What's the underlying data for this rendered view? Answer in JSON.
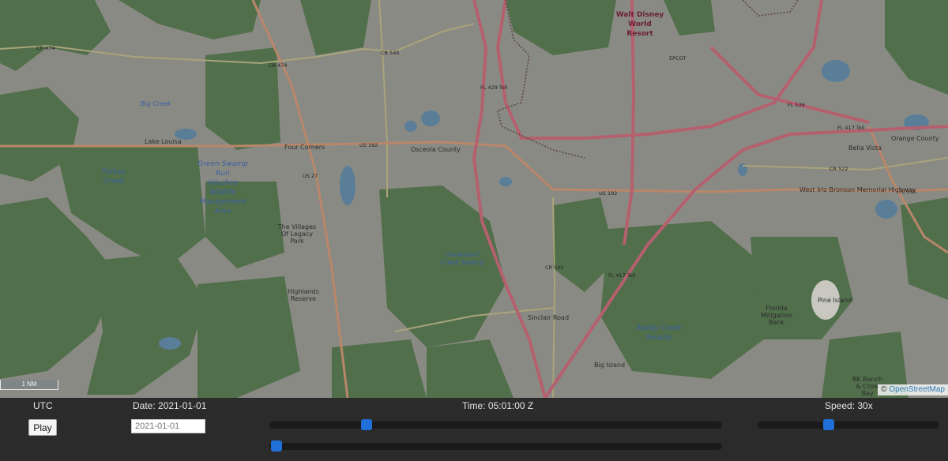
{
  "map": {
    "scale_label": "1 NM",
    "attribution_symbol": "©",
    "attribution_link": "OpenStreetMap",
    "labels": {
      "cr474_a": "CR 474",
      "cr474_b": "CR 474",
      "cr545_top": "CR 545",
      "cr545_mid": "CR 545",
      "fl429": "FL 429 Toll",
      "fl536": "FL 536",
      "fl417_top": "FL 417 Toll",
      "fl417_mid": "FL 417 Toll",
      "cr522": "CR 522",
      "fl535": "FL 535",
      "us192_left": "US 192",
      "us192_right": "US 192",
      "us27": "US 27",
      "four_corners": "Four Corners",
      "wdw_line1": "Walt Disney",
      "wdw_line2": "World",
      "wdw_line3": "Resort",
      "epcot": "EPCOT",
      "turkey_line1": "Turkey",
      "turkey_line2": "Creek",
      "gsr_line1": "Green Swamp",
      "gsr_line2": "Run",
      "gsr_line3": "Hilochee",
      "gsr_line4": "Wildlife",
      "gsr_line5": "Management",
      "gsr_line6": "Area",
      "big_creek": "Big Creek",
      "lake_line": "Lake Louisa",
      "davenport_line1": "Davenport",
      "davenport_line2": "Creek Swamp",
      "reedy_line1": "Reedy Creek",
      "reedy_line2": "Swamp",
      "pine_island": "Pine Island",
      "big_island": "Big Island",
      "osceola_county": "Osceola County",
      "orange_county": "Orange County",
      "villages_line1": "The Villages",
      "villages_line2": "Of Legacy",
      "villages_line3": "Park",
      "highlands_line1": "Highlands",
      "highlands_line2": "Reserve",
      "sinclair": "Sinclair Road",
      "florida_line1": "Florida",
      "florida_line2": "Mitigation",
      "florida_line3": "Bank",
      "bk_line1": "BK Ranch",
      "bk_line2": "& Crow",
      "bk_line3": "Bay",
      "bella_vista": "Bella Vista",
      "irlo": "West Irlo Bronson Memorial Highway"
    }
  },
  "controls": {
    "timezone_label": "UTC",
    "play_label": "Play",
    "date_label": "Date: 2021-01-01",
    "date_placeholder": "2021-01-01",
    "time_label": "Time: 05:01:00 Z",
    "speed_label": "Speed: 30x",
    "time_slider_fraction": 0.215,
    "second_slider_fraction": 0.015,
    "speed_slider_fraction": 0.39
  },
  "colors": {
    "map_base": "#8a8a84",
    "forest": "#4f6e48",
    "water": "#5a7e98",
    "toll_road": "#b5606e",
    "major_road": "#b9876a",
    "secondary_road": "#a9a47a",
    "slider_thumb": "#1f70d8",
    "control_bar": "#2b2b2b"
  }
}
